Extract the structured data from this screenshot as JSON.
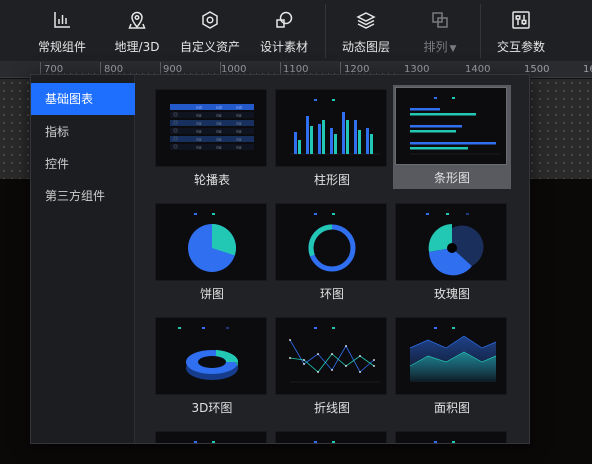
{
  "toolbar": {
    "items": [
      {
        "label": "常规组件",
        "icon": "bar-chart-icon"
      },
      {
        "label": "地理/3D",
        "icon": "map-pin-icon"
      },
      {
        "label": "自定义资产",
        "icon": "hexagon-icon"
      },
      {
        "label": "设计素材",
        "icon": "shapes-icon"
      },
      {
        "label": "动态图层",
        "icon": "layers-icon"
      },
      {
        "label": "排列",
        "icon": "arrange-icon"
      },
      {
        "label": "交互参数",
        "icon": "sliders-icon"
      }
    ]
  },
  "ruler": {
    "labels": [
      "700",
      "800",
      "900",
      "1000",
      "1100",
      "1200",
      "1300",
      "1400",
      "1500",
      "16"
    ]
  },
  "panel": {
    "categories": [
      "基础图表",
      "指标",
      "控件",
      "第三方组件"
    ],
    "active_category": "基础图表",
    "cards": [
      {
        "label": "轮播表"
      },
      {
        "label": "柱形图"
      },
      {
        "label": "条形图",
        "selected": true
      },
      {
        "label": "饼图"
      },
      {
        "label": "环图"
      },
      {
        "label": "玫瑰图"
      },
      {
        "label": "3D环图"
      },
      {
        "label": "折线图"
      },
      {
        "label": "面积图"
      }
    ]
  },
  "colors": {
    "accent": "#1f6fff",
    "series_blue": "#2f6ff0",
    "series_teal": "#23c8b4"
  }
}
